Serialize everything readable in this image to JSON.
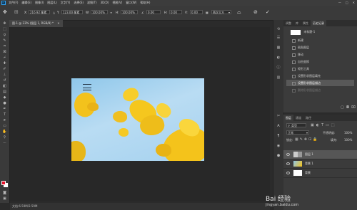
{
  "menubar": {
    "menus": [
      "文件(F)",
      "编辑(E)",
      "图像(I)",
      "图层(L)",
      "文字(Y)",
      "选择(S)",
      "滤镜(T)",
      "3D(D)",
      "视图(V)",
      "窗口(W)",
      "帮助(H)"
    ],
    "window_controls": [
      "—",
      "□",
      "✕"
    ]
  },
  "options": {
    "x_label": "X:",
    "x_value": "216.92 像素",
    "y_label": "Y:",
    "y_value": "123.00 像素",
    "w_label": "W:",
    "w_value": "100.00%",
    "h_label": "H:",
    "h_value": "100.00%",
    "angle_value": "0.00",
    "h_skew_label": "H:",
    "h_skew_value": "0.00",
    "v_skew_label": "V:",
    "v_skew_value": "0.00",
    "interp_value": "两次立方"
  },
  "document": {
    "tab_title": "图-1 @ 23% (图层 1, RGB/8) *",
    "close_symbol": "×"
  },
  "status": {
    "text": "文档:6.59M/3.59M"
  },
  "history": {
    "tabs": [
      "调整",
      "库",
      "属性",
      "历史记录"
    ],
    "snapshot_name": "未标题-1",
    "items": [
      "新建",
      "粘贴图层",
      "移动",
      "自由变换",
      "矩形工具",
      "设置形状图层填充",
      "设置形状图层描边"
    ],
    "ghost_item": "删除形状图层描边",
    "selected_index": 6
  },
  "layers": {
    "tabs": [
      "图层",
      "通道",
      "路径"
    ],
    "kind_label": "类型",
    "blend_mode": "正常",
    "opacity_label": "不透明度:",
    "opacity_value": "100%",
    "lock_label": "锁定:",
    "fill_label": "填充:",
    "fill_value": "100%",
    "rows": [
      {
        "name": "图层 1",
        "selected": true
      },
      {
        "name": "背景 1",
        "selected": false
      },
      {
        "name": "背景",
        "selected": false
      }
    ]
  },
  "colors": {
    "foreground": "#e8132b",
    "background": "#ffffff",
    "selection": "#585858"
  },
  "watermark": {
    "title": "Bai 经验",
    "url": "jingyan.baidu.com"
  }
}
